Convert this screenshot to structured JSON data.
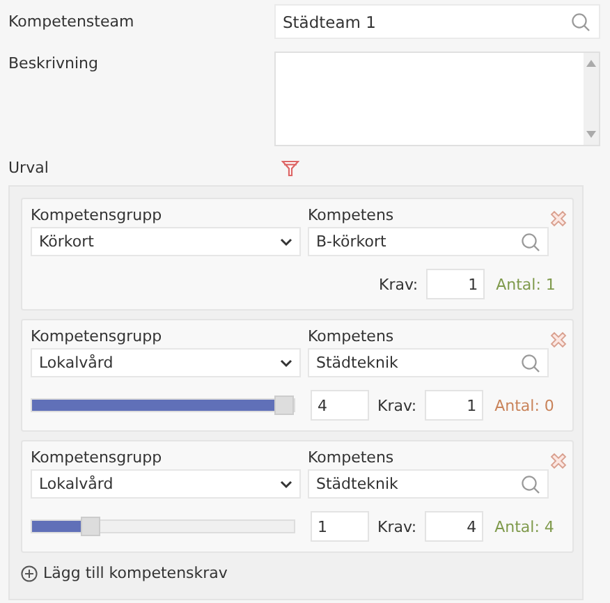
{
  "team": {
    "label": "Kompetensteam",
    "value": "Städteam 1"
  },
  "description": {
    "label": "Beskrivning"
  },
  "selection": {
    "label": "Urval"
  },
  "requirements": [
    {
      "kind": "plain",
      "group_label": "Kompetensgrupp",
      "group": "Körkort",
      "competence_label": "Kompetens",
      "competence": "B-körkort",
      "krav_label": "Krav:",
      "krav": "1",
      "antal": "Antal: 1",
      "color": "#7f9a4c"
    },
    {
      "kind": "slider",
      "group_label": "Kompetensgrupp",
      "group": "Lokalvård",
      "competence_label": "Kompetens",
      "competence": "Städteknik",
      "level": 1.0,
      "slider_value": "4",
      "krav_label": "Krav:",
      "krav": "1",
      "antal": "Antal: 0",
      "color": "#c9835a"
    },
    {
      "kind": "slider",
      "group_label": "Kompetensgrupp",
      "group": "Lokalvård",
      "competence_label": "Kompetens",
      "competence": "Städteknik",
      "level": 0.2,
      "slider_value": "1",
      "krav_label": "Krav:",
      "krav": "4",
      "antal": "Antal: 4",
      "color": "#7f9a4c"
    }
  ],
  "add_link": "Lägg till kompetenskrav"
}
